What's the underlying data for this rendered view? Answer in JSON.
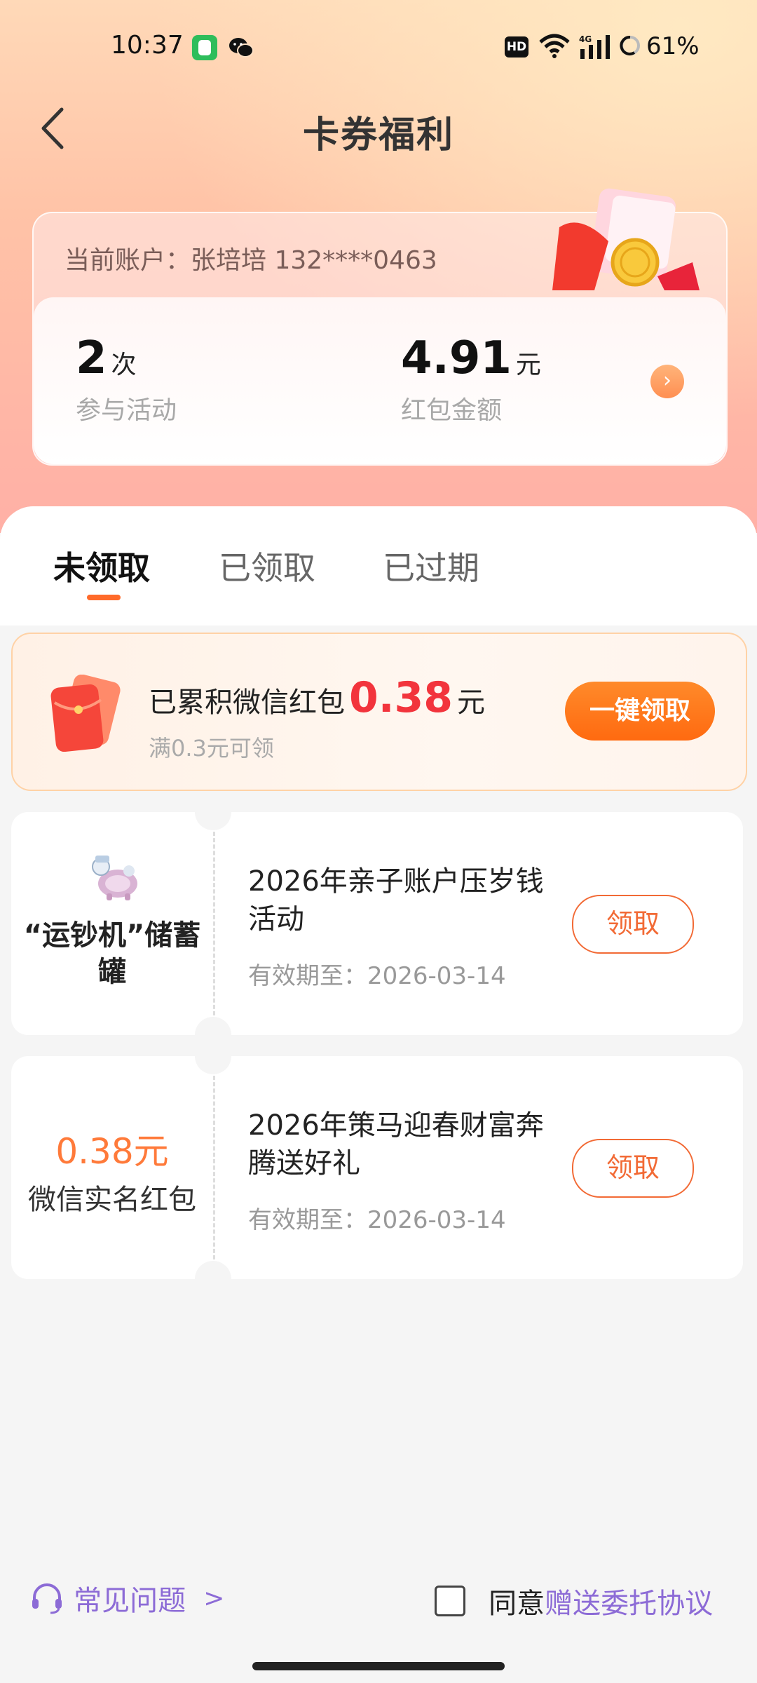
{
  "status_bar": {
    "time": "10:37",
    "hd": "HD",
    "network": "4G",
    "battery": "61%"
  },
  "header": {
    "title": "卡券福利"
  },
  "account": {
    "label": "当前账户：张培培  132****0463",
    "stats": [
      {
        "value": "2",
        "unit": "次",
        "label": "参与活动"
      },
      {
        "value": "4.91",
        "unit": "元",
        "label": "红包金额"
      }
    ]
  },
  "tabs": [
    {
      "label": "未领取",
      "active": true
    },
    {
      "label": "已领取",
      "active": false
    },
    {
      "label": "已过期",
      "active": false
    }
  ],
  "banner": {
    "prefix": "已累积微信红包",
    "amount": "0.38",
    "unit": "元",
    "subtext": "满0.3元可领",
    "button": "一键领取"
  },
  "coupons": [
    {
      "left_title": "“运钞机”储蓄罐",
      "title": "2026年亲子账户压岁钱活动",
      "expiry": "有效期至：2026-03-14",
      "button": "领取"
    },
    {
      "left_amount": "0.38元",
      "left_sub": "微信实名红包",
      "title": "2026年策马迎春财富奔腾送好礼",
      "expiry": "有效期至：2026-03-14",
      "button": "领取"
    }
  ],
  "footer": {
    "faq": "常见问题",
    "faq_arrow": ">",
    "agree_prefix": "同意",
    "agree_link": "赠送委托协议"
  },
  "colors": {
    "accent": "#ff6a2a",
    "amount_red": "#f2343c",
    "link_purple": "#8c6bd6"
  }
}
